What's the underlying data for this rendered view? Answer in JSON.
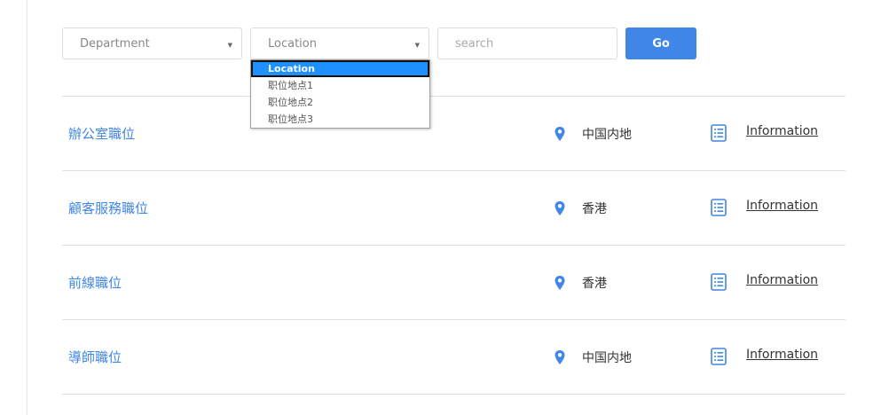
{
  "filters": {
    "department": {
      "value": "Department"
    },
    "location": {
      "value": "Location",
      "options": [
        "Location",
        "职位地点1",
        "职位地点2",
        "职位地点3"
      ],
      "selected_index": 0
    },
    "search": {
      "placeholder": "search",
      "value": ""
    },
    "go_label": "Go"
  },
  "jobs": [
    {
      "title": "辦公室職位",
      "location": "中国内地",
      "info_label": "Information"
    },
    {
      "title": "顧客服務職位",
      "location": "香港",
      "info_label": "Information"
    },
    {
      "title": "前線職位",
      "location": "香港",
      "info_label": "Information"
    },
    {
      "title": "導師職位",
      "location": "中国内地",
      "info_label": "Information"
    }
  ],
  "colors": {
    "accent": "#3f86e6",
    "dropdown_highlight": "#1e90ff"
  }
}
